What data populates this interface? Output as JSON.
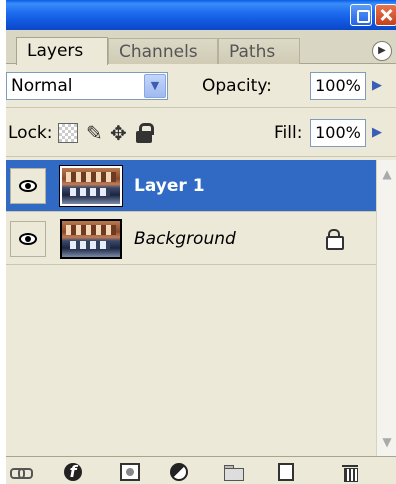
{
  "tabs": [
    {
      "label": "Layers",
      "active": true
    },
    {
      "label": "Channels",
      "active": false
    },
    {
      "label": "Paths",
      "active": false
    }
  ],
  "blend": {
    "mode": "Normal"
  },
  "opacity": {
    "label": "Opacity:",
    "value": "100%"
  },
  "lock": {
    "label": "Lock:"
  },
  "fill": {
    "label": "Fill:",
    "value": "100%"
  },
  "layers": [
    {
      "name": "Layer 1",
      "selected": true,
      "visible": true
    },
    {
      "name": "Background",
      "selected": false,
      "visible": true,
      "locked": true
    }
  ],
  "colors": {
    "title_bar": "#1f6ef0",
    "selected_row": "#316ac5",
    "panel_bg": "#ece9d8"
  },
  "icons": {
    "toolbar": [
      "link-layers-icon",
      "layer-style-icon",
      "layer-mask-icon",
      "adjustment-layer-icon",
      "new-group-icon",
      "new-layer-icon",
      "delete-layer-icon"
    ]
  }
}
